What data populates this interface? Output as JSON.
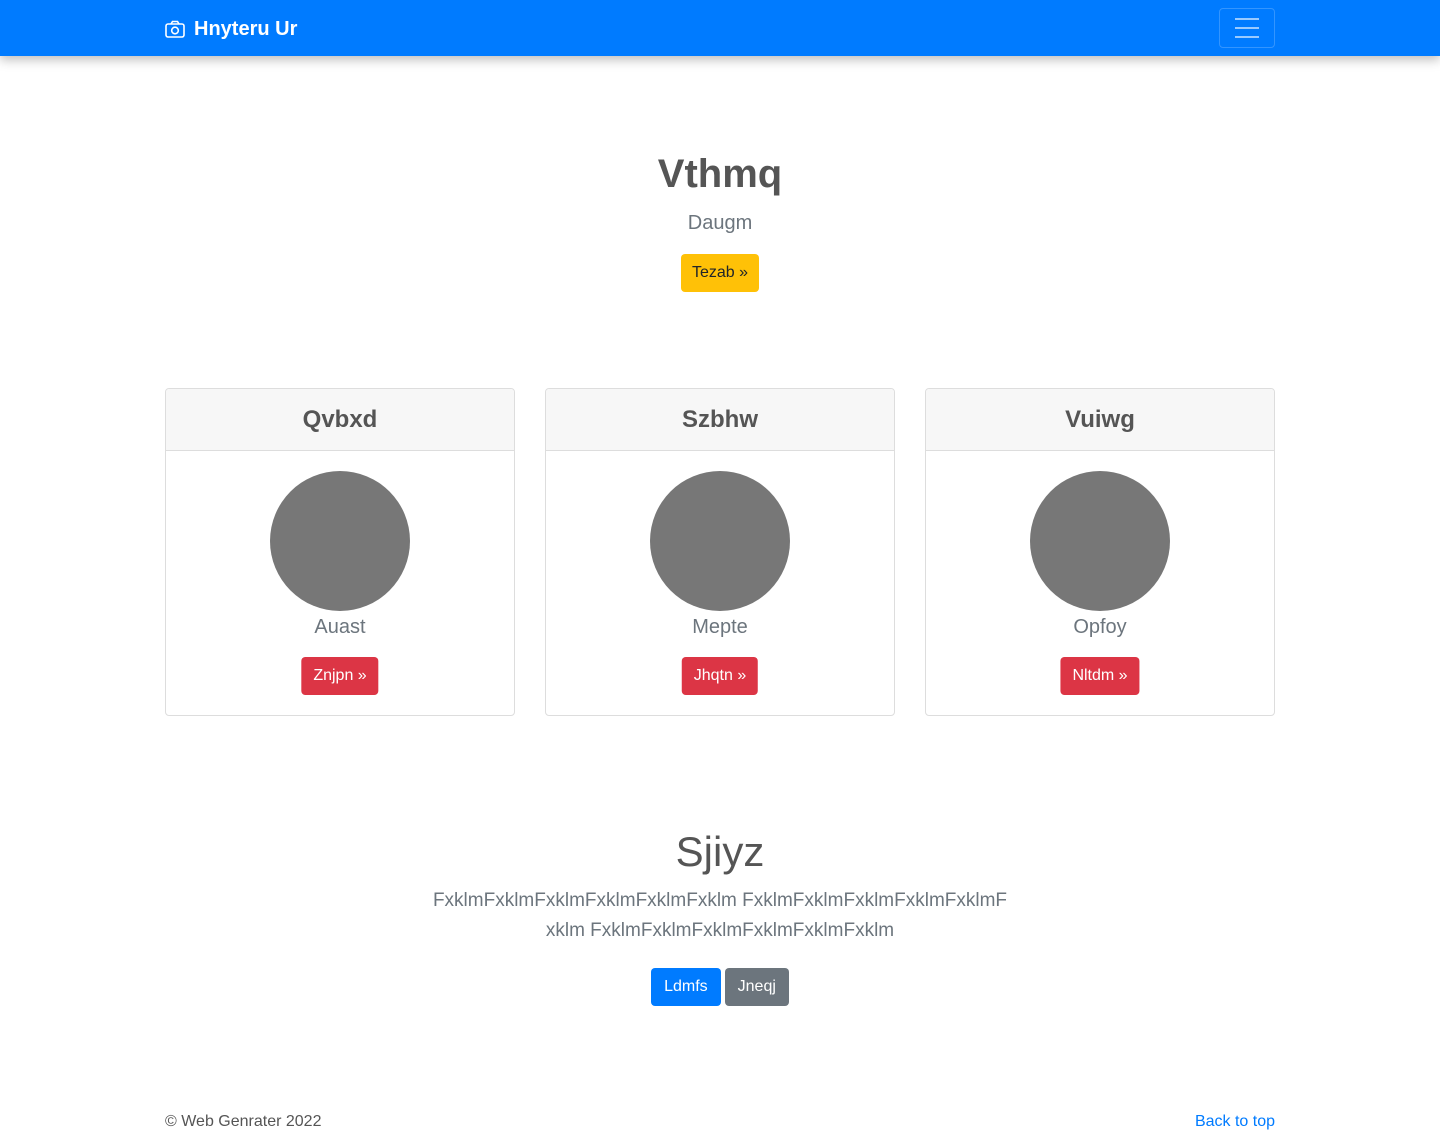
{
  "navbar": {
    "brand": "Hnyteru Ur",
    "brand_icon": "camera-icon",
    "toggler_icon": "hamburger-menu-icon",
    "color": "#007bff"
  },
  "hero": {
    "title": "Vthmq",
    "subtitle": "Daugm",
    "button": "Tezab »",
    "button_color": "#ffc107"
  },
  "cards": [
    {
      "header": "Qvbxd",
      "text": "Auast",
      "button": "Znjpn »"
    },
    {
      "header": "Szbhw",
      "text": "Mepte",
      "button": "Jhqtn »"
    },
    {
      "header": "Vuiwg",
      "text": "Opfoy",
      "button": "Nltdm »"
    }
  ],
  "card_button_color": "#dc3545",
  "section": {
    "title": "Sjiyz",
    "text": "FxklmFxklmFxklmFxklmFxklmFxklm FxklmFxklmFxklmFxklmFxklmFxklm FxklmFxklmFxklmFxklmFxklmFxklm",
    "primary_button": "Ldmfs",
    "secondary_button": "Jneqj"
  },
  "footer": {
    "copyright": "© Web Genrater 2022",
    "back_to_top": "Back to top",
    "link_color": "#007bff"
  }
}
